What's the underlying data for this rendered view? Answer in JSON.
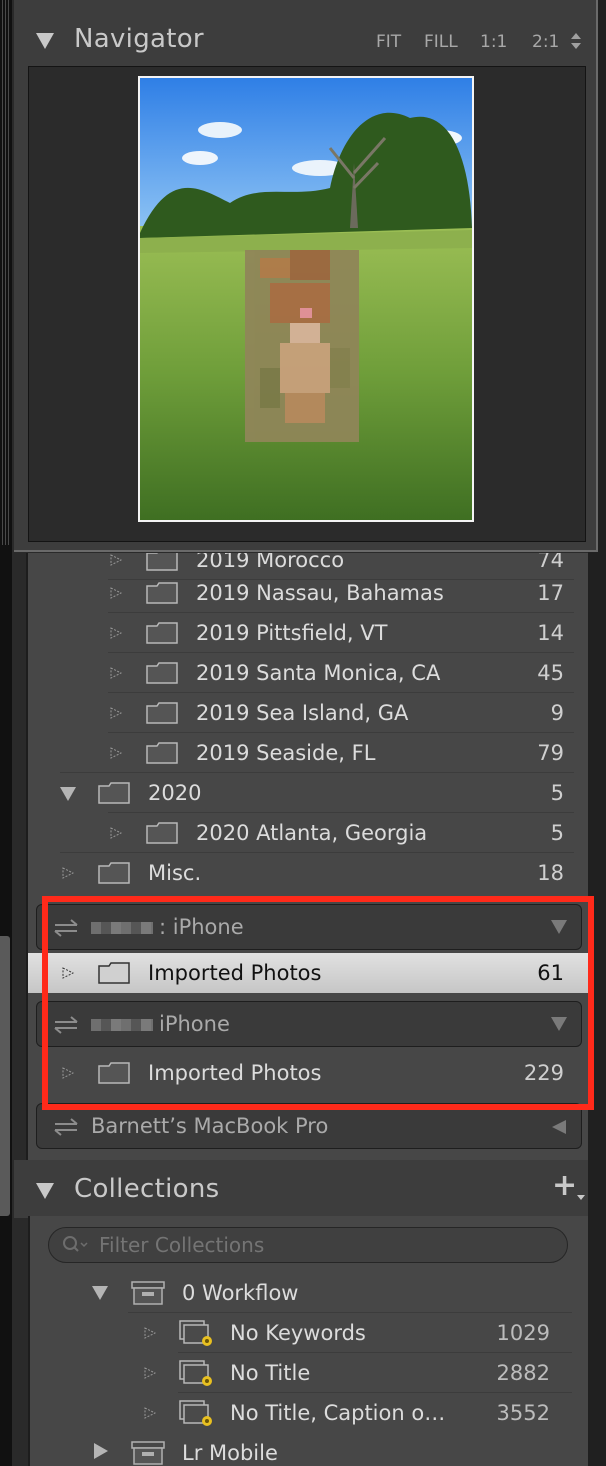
{
  "navigator": {
    "title": "Navigator",
    "zoom_options": [
      "FIT",
      "FILL",
      "1:1",
      "2:1"
    ]
  },
  "folders": [
    {
      "name": "2019 Morocco",
      "count": "74",
      "level": 2,
      "partial": true
    },
    {
      "name": "2019 Nassau, Bahamas",
      "count": "17",
      "level": 2
    },
    {
      "name": "2019 Pittsfield, VT",
      "count": "14",
      "level": 2
    },
    {
      "name": "2019 Santa Monica, CA",
      "count": "45",
      "level": 2
    },
    {
      "name": "2019 Sea Island, GA",
      "count": "9",
      "level": 2
    },
    {
      "name": "2019 Seaside, FL",
      "count": "79",
      "level": 2
    },
    {
      "name": "2020",
      "count": "5",
      "level": 1,
      "expanded": true
    },
    {
      "name": "2020 Atlanta, Georgia",
      "count": "5",
      "level": 2
    },
    {
      "name": "Misc.",
      "count": "18",
      "level": 1
    }
  ],
  "volumes": [
    {
      "name": ": iPhone",
      "folder": {
        "name": "Imported Photos",
        "count": "61",
        "selected": true
      }
    },
    {
      "name": "iPhone",
      "folder": {
        "name": "Imported Photos",
        "count": "229"
      }
    },
    {
      "name": "Barnett’s MacBook Pro"
    }
  ],
  "collections": {
    "title": "Collections",
    "add_label": "+",
    "filter_placeholder": "Filter Collections",
    "items": [
      {
        "name": "0 Workflow",
        "type": "set",
        "expanded": true
      },
      {
        "name": "No Keywords",
        "count": "1029",
        "type": "smart"
      },
      {
        "name": "No Title",
        "count": "2882",
        "type": "smart"
      },
      {
        "name": "No Title, Caption o…",
        "count": "3552",
        "type": "smart"
      },
      {
        "name": "Lr Mobile",
        "type": "set",
        "expanded": false
      }
    ]
  },
  "colors": {
    "highlight": "#ff2a1a",
    "selected_row": "#d8d8d8",
    "panel": "#3d3d3d"
  }
}
